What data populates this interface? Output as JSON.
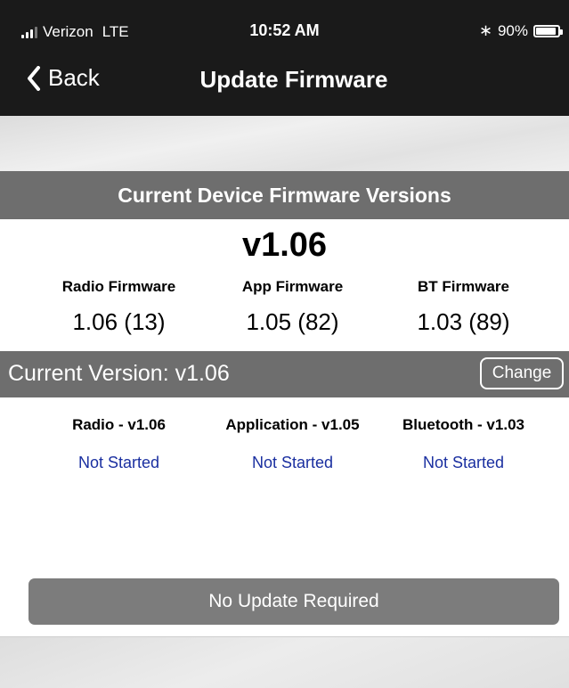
{
  "status_bar": {
    "carrier": "Verizon",
    "network": "LTE",
    "time": "10:52 AM",
    "battery": "90%"
  },
  "nav": {
    "back_label": "Back",
    "title": "Update Firmware"
  },
  "firmware": {
    "section_title": "Current Device Firmware Versions",
    "version": "v1.06",
    "columns": [
      {
        "label": "Radio Firmware",
        "value": "1.06 (13)"
      },
      {
        "label": "App Firmware",
        "value": "1.05 (82)"
      },
      {
        "label": "BT Firmware",
        "value": "1.03 (89)"
      }
    ]
  },
  "current": {
    "label": "Current Version: v1.06",
    "change_label": "Change"
  },
  "updates": [
    {
      "label": "Radio - v1.06",
      "status": "Not Started"
    },
    {
      "label": "Application - v1.05",
      "status": "Not Started"
    },
    {
      "label": "Bluetooth - v1.03",
      "status": "Not Started"
    }
  ],
  "update_button_label": "No Update Required",
  "colors": {
    "header_bg": "#1a1a1a",
    "section_bg": "#6e6e6e",
    "status_link": "#1a2fa0",
    "button_bg": "#7c7c7c"
  }
}
